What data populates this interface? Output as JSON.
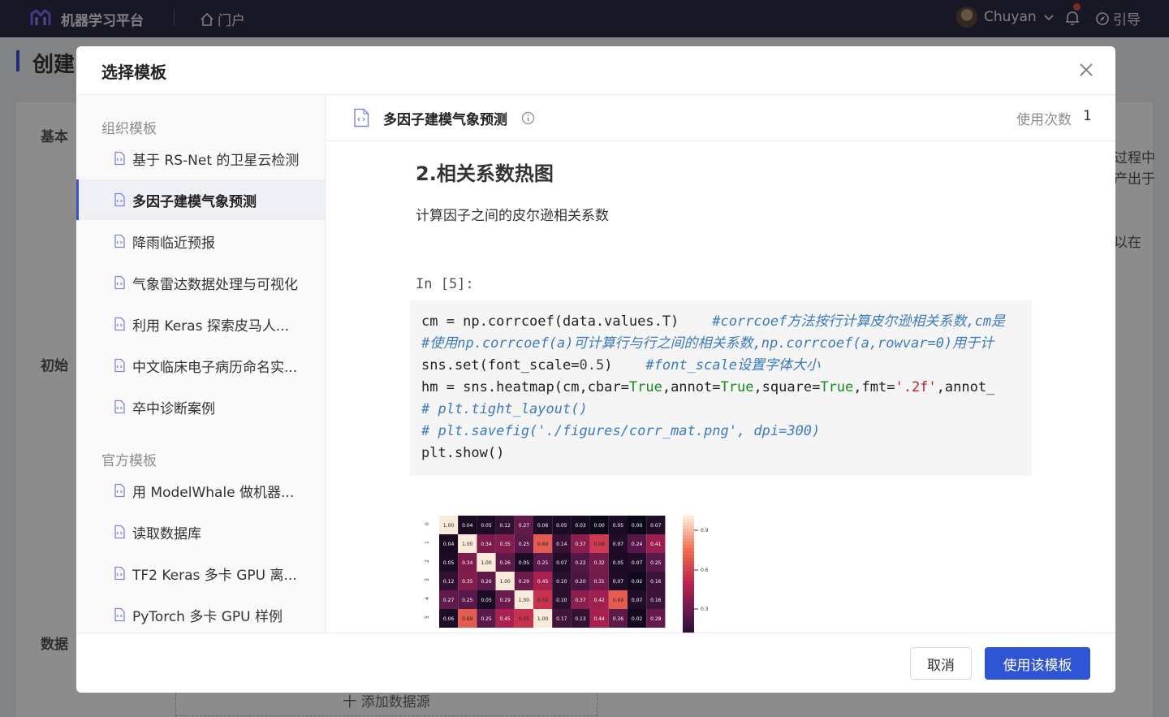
{
  "topbar": {
    "app_title": "机器学习平台",
    "portal": "门户",
    "user_name": "Chuyan",
    "guide": "引导"
  },
  "background": {
    "page_title": "创建",
    "labels": [
      "基本",
      "初始",
      "数据"
    ],
    "right_text": [
      "过程中",
      "产出于",
      "以在"
    ],
    "add_datasource": "十 添加数据源"
  },
  "modal": {
    "title": "选择模板",
    "groups": [
      {
        "label": "组织模板",
        "items": [
          "基于 RS-Net 的卫星云检测",
          "多因子建模气象预测",
          "降雨临近预报",
          "气象雷达数据处理与可视化",
          "利用 Keras 探索皮马人...",
          "中文临床电子病历命名实...",
          "卒中诊断案例"
        ]
      },
      {
        "label": "官方模板",
        "items": [
          "用 ModelWhale 做机器...",
          "读取数据库",
          "TF2 Keras 多卡 GPU 离...",
          "PyTorch 多卡 GPU 样例"
        ]
      }
    ],
    "active_item": "多因子建模气象预测",
    "content": {
      "title": "多因子建模气象预测",
      "usage_label": "使用次数",
      "usage_count": "1",
      "heading": "2.相关系数热图",
      "paragraph": "计算因子之间的皮尔逊相关系数",
      "prompt": "In [5]:"
    },
    "cancel_label": "取消",
    "confirm_label": "使用该模板"
  },
  "heatmap": {
    "values": [
      [
        1.0,
        0.04,
        0.05,
        0.12,
        0.27,
        0.06,
        0.05,
        0.03,
        0.0,
        0.05,
        0.0,
        0.07
      ],
      [
        0.04,
        1.0,
        0.34,
        0.35,
        0.25,
        0.69,
        0.14,
        0.37,
        0.58,
        0.07,
        0.24,
        0.41
      ],
      [
        0.05,
        0.34,
        1.0,
        0.26,
        0.05,
        0.25,
        0.07,
        0.22,
        0.32,
        0.05,
        0.07,
        0.25
      ],
      [
        0.12,
        0.35,
        0.26,
        1.0,
        0.29,
        0.45,
        0.1,
        0.2,
        0.31,
        0.07,
        0.02,
        0.16
      ],
      [
        0.27,
        0.25,
        0.05,
        0.29,
        1.0,
        0.55,
        0.1,
        0.37,
        0.42,
        0.69,
        0.07,
        0.16
      ],
      [
        0.06,
        0.69,
        0.25,
        0.45,
        0.55,
        1.0,
        0.17,
        0.13,
        0.44,
        0.26,
        0.02,
        0.28
      ]
    ],
    "row_labels": [
      "0",
      "1",
      "2",
      "3",
      "4",
      "5"
    ],
    "colorbar_ticks": [
      "0.9",
      "0.6",
      "0.3"
    ]
  }
}
